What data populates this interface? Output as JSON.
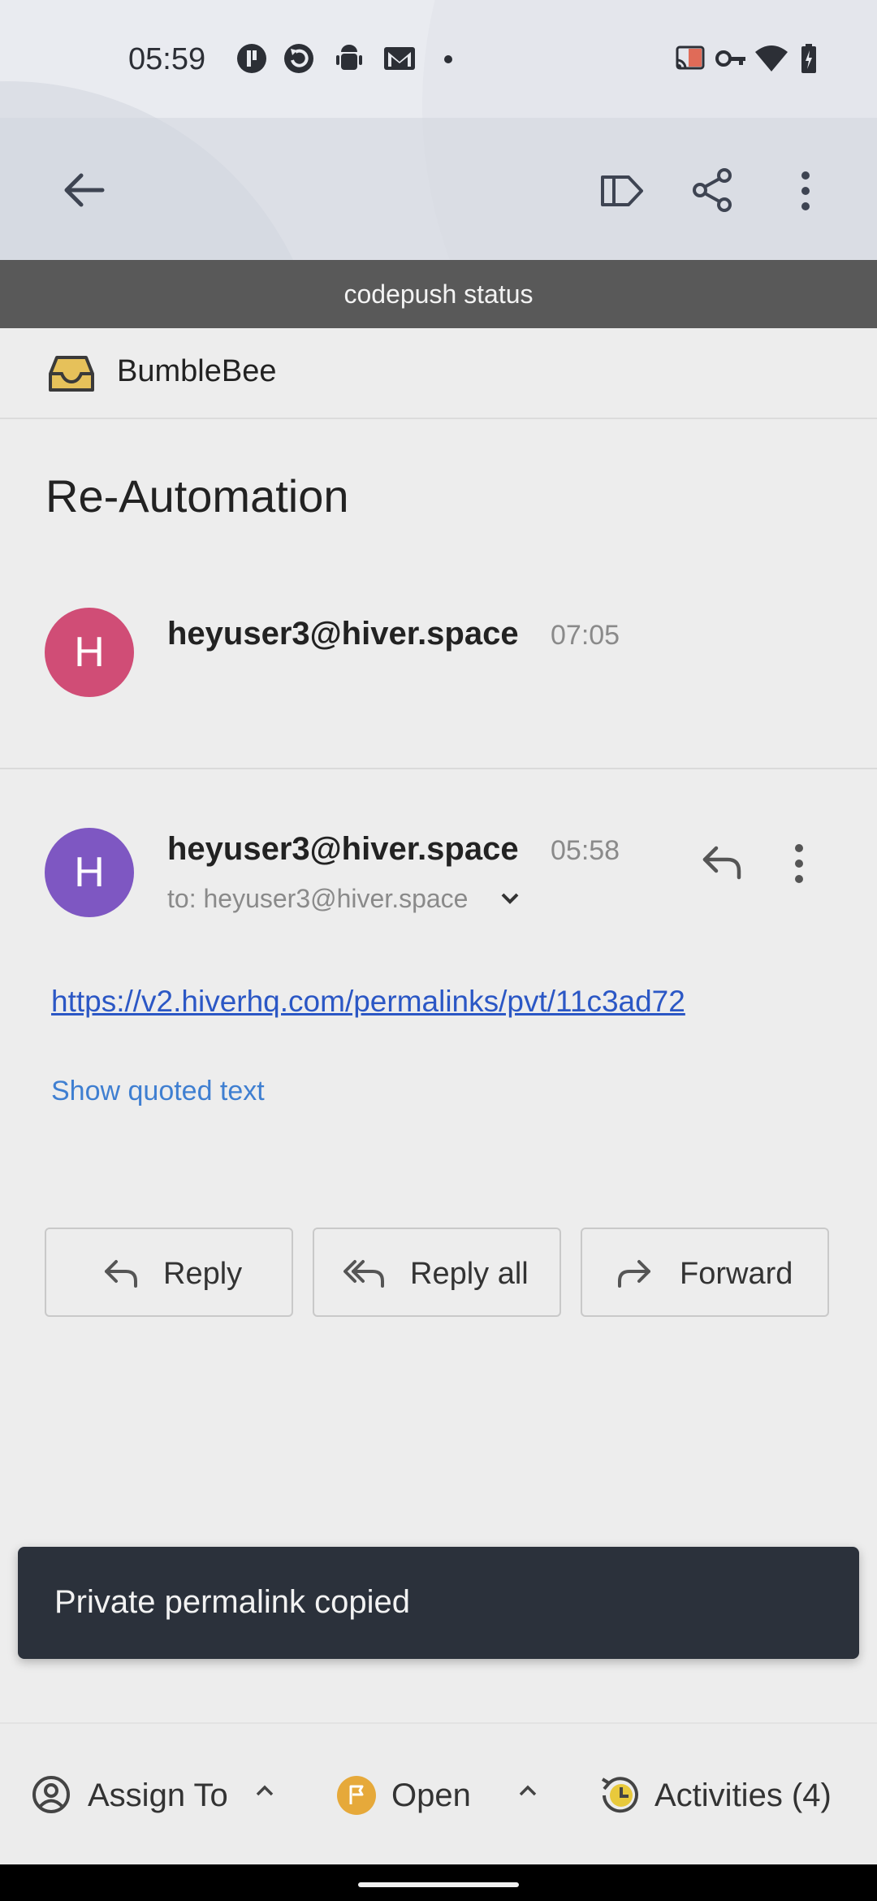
{
  "status_bar": {
    "time": "05:59",
    "left_icons": [
      "p-icon",
      "refresh-icon",
      "android-icon",
      "gmail-icon",
      "dot-icon"
    ],
    "right_icons": [
      "cast-icon",
      "key-icon",
      "wifi-icon",
      "battery-icon"
    ]
  },
  "app_bar": {
    "icons": [
      "back-arrow-icon",
      "label-icon",
      "share-icon",
      "more-vert-icon"
    ]
  },
  "banner": {
    "text": "codepush status"
  },
  "mailbox": {
    "name": "BumbleBee",
    "icon": "inbox-icon"
  },
  "conversation": {
    "subject": "Re-Automation",
    "messages": [
      {
        "avatar_letter": "H",
        "avatar_color": "#d04d76",
        "sender": "heyuser3@hiver.space",
        "time": "07:05"
      },
      {
        "avatar_letter": "H",
        "avatar_color": "#7e57c2",
        "sender": "heyuser3@hiver.space",
        "time": "05:58",
        "to": "to: heyuser3@hiver.space",
        "link": "https://v2.hiverhq.com/permalinks/pvt/11c3ad72",
        "show_quoted": "Show quoted text"
      }
    ]
  },
  "actions": {
    "reply": "Reply",
    "reply_all": "Reply all",
    "forward": "Forward"
  },
  "toast": {
    "text": "Private permalink copied"
  },
  "bottom_bar": {
    "assign": "Assign To",
    "status": "Open",
    "status_color": "#e6a93a",
    "activities": "Activities (4)"
  }
}
